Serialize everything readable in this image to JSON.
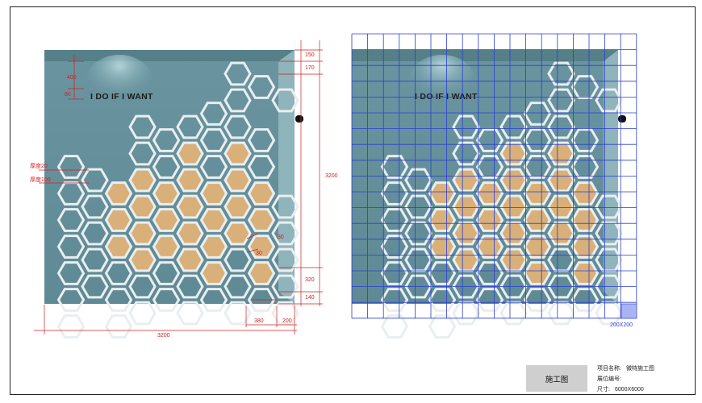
{
  "drawing": {
    "brand_text": "I DO IF I WANT",
    "left_panel": {
      "dims_right": [
        "150",
        "170",
        "3200",
        "320",
        "140"
      ],
      "dims_left": [
        "400",
        "80"
      ],
      "thickness_labels": [
        "厚度20",
        "厚度100"
      ],
      "small_dims": [
        "30",
        "30"
      ],
      "dims_bottom": [
        "380",
        "200"
      ],
      "total_width": "3200"
    },
    "right_panel": {
      "grid_label": "200X200"
    }
  },
  "title_block": {
    "stamp": "施工图",
    "project_label": "项目名称:",
    "project_value": "微特施工图",
    "booth_label": "展位编号:",
    "booth_value": "",
    "size_label": "尺寸:",
    "size_value": "6000X6000"
  },
  "colors": {
    "wall": "#6e9aa3",
    "wall_dark": "#5a858f",
    "hex_stroke": "#e9eef0",
    "hex_fill_wood": "#d9b079",
    "dimension": "#d02020",
    "grid": "#2a3fd0",
    "stamp_bg": "#cfcfcf"
  }
}
